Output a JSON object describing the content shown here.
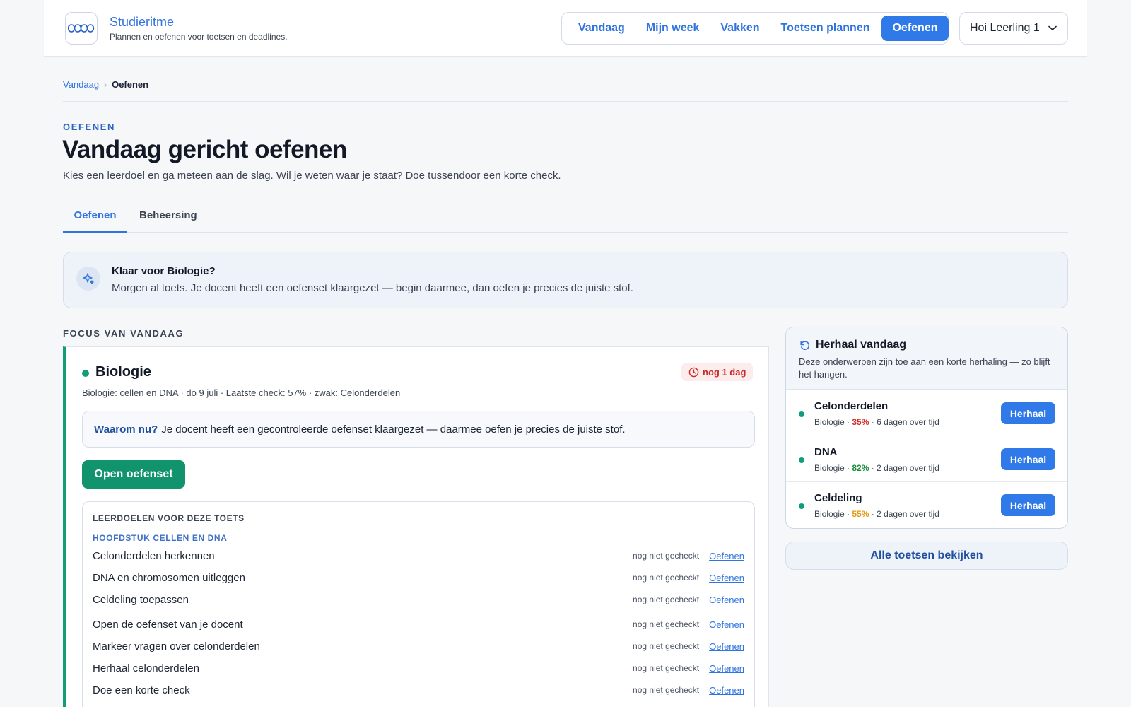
{
  "header": {
    "brand_title": "Studieritme",
    "brand_subtitle": "Plannen en oefenen voor toetsen en deadlines.",
    "nav": [
      {
        "label": "Vandaag"
      },
      {
        "label": "Mijn week"
      },
      {
        "label": "Vakken"
      },
      {
        "label": "Toetsen plannen"
      },
      {
        "label": "Oefenen",
        "active": true
      }
    ],
    "user_label": "Hoi Leerling 1"
  },
  "breadcrumb": {
    "parent": "Vandaag",
    "separator": "›",
    "current": "Oefenen"
  },
  "page": {
    "eyebrow": "OEFENEN",
    "title": "Vandaag gericht oefenen",
    "subtitle": "Kies een leerdoel en ga meteen aan de slag. Wil je weten waar je staat? Doe tussendoor een korte check."
  },
  "tabs": [
    {
      "label": "Oefenen",
      "active": true
    },
    {
      "label": "Beheersing"
    }
  ],
  "banner": {
    "title": "Klaar voor Biologie?",
    "text": "Morgen al toets. Je docent heeft een oefenset klaargezet — begin daarmee, dan oefen je precies de juiste stof."
  },
  "focus": {
    "section_label": "FOCUS VAN VANDAAG",
    "subject": "Biologie",
    "deadline": "nog 1 dag",
    "meta": "Biologie: cellen en DNA · do 9 juli · Laatste check: 57% · zwak: Celonderdelen",
    "why_label": "Waarom nu?",
    "why_text": "Je docent heeft een gecontroleerde oefenset klaargezet — daarmee oefen je precies de juiste stof.",
    "open_button": "Open oefenset",
    "goals_heading": "LEERDOELEN VOOR DEZE TOETS",
    "chapter": "HOOFDSTUK CELLEN EN DNA",
    "goals": [
      {
        "label": "Celonderdelen herkennen",
        "status": "nog niet gecheckt",
        "action": "Oefenen"
      },
      {
        "label": "DNA en chromosomen uitleggen",
        "status": "nog niet gecheckt",
        "action": "Oefenen"
      },
      {
        "label": "Celdeling toepassen",
        "status": "nog niet gecheckt",
        "action": "Oefenen"
      },
      {
        "label": "Open de oefenset van je docent",
        "status": "nog niet gecheckt",
        "action": "Oefenen"
      },
      {
        "label": "Markeer vragen over celonderdelen",
        "status": "nog niet gecheckt",
        "action": "Oefenen"
      },
      {
        "label": "Herhaal celonderdelen",
        "status": "nog niet gecheckt",
        "action": "Oefenen"
      },
      {
        "label": "Doe een korte check",
        "status": "nog niet gecheckt",
        "action": "Oefenen"
      }
    ]
  },
  "repeat": {
    "title": "Herhaal vandaag",
    "subtitle": "Deze onderwerpen zijn toe aan een korte herhaling — zo blijft het hangen.",
    "items": [
      {
        "title": "Celonderdelen",
        "subject": "Biologie",
        "sep1": " · ",
        "percent": "35%",
        "percent_color": "#d62b2b",
        "sep2": " · ",
        "overdue": "6 dagen over tijd",
        "button": "Herhaal"
      },
      {
        "title": "DNA",
        "subject": "Biologie",
        "sep1": " · ",
        "percent": "82%",
        "percent_color": "#1b8a3a",
        "sep2": " · ",
        "overdue": "2 dagen over tijd",
        "button": "Herhaal"
      },
      {
        "title": "Celdeling",
        "subject": "Biologie",
        "sep1": " · ",
        "percent": "55%",
        "percent_color": "#e39a12",
        "sep2": " · ",
        "overdue": "2 dagen over tijd",
        "button": "Herhaal"
      }
    ],
    "all_button": "Alle toetsen bekijken"
  },
  "colors": {
    "accent": "#2f7ae8",
    "success": "#11936d",
    "danger": "#c72828"
  }
}
